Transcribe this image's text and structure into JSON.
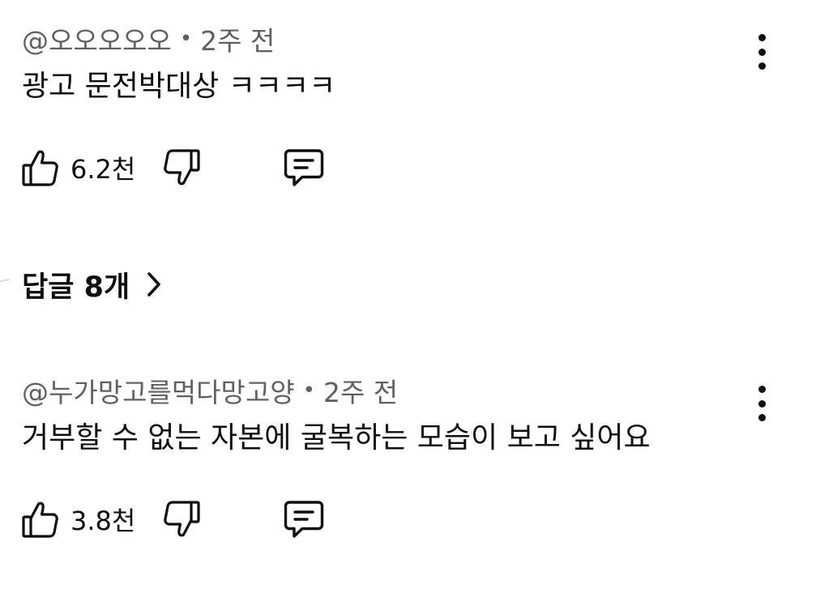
{
  "comments": [
    {
      "author": "@오오오오오",
      "time": "2주 전",
      "separator": "•",
      "text": "광고 문전박대상 ㅋㅋㅋㅋ",
      "like_count": "6.2천"
    },
    {
      "author": "@누가망고를먹다망고양",
      "time": "2주 전",
      "separator": "•",
      "text": "거부할 수 없는 자본에 굴복하는 모습이 보고 싶어요",
      "like_count": "3.8천"
    }
  ],
  "replies": {
    "label": "답글 8개"
  },
  "icons": {
    "like": "thumbs-up-icon",
    "dislike": "thumbs-down-icon",
    "reply": "comment-icon",
    "more": "more-vertical-icon",
    "expand": "chevron-right-icon"
  },
  "colors": {
    "text_primary": "#0f0f0f",
    "text_secondary": "#606060",
    "background": "#ffffff"
  }
}
